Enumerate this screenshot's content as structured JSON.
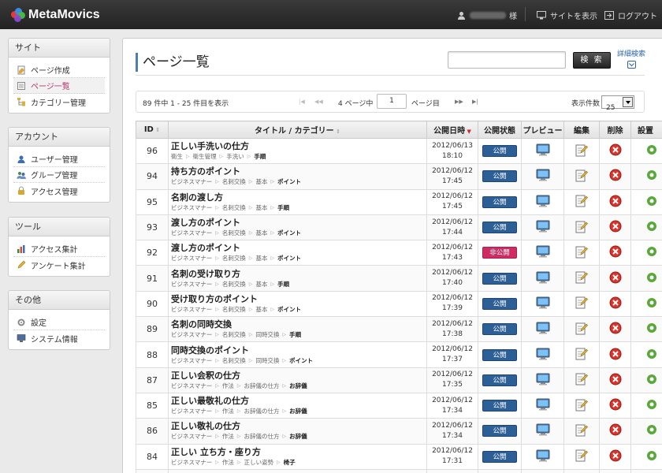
{
  "app": {
    "name": "MetaMovics"
  },
  "topbar": {
    "user_suffix": "様",
    "view_site": "サイトを表示",
    "logout": "ログアウト"
  },
  "sidebar": [
    {
      "heading": "サイト",
      "items": [
        {
          "label": "ページ作成",
          "icon": "page-create-icon"
        },
        {
          "label": "ページ一覧",
          "icon": "page-list-icon",
          "active": true
        },
        {
          "label": "カテゴリー管理",
          "icon": "category-icon"
        }
      ]
    },
    {
      "heading": "アカウント",
      "items": [
        {
          "label": "ユーザー管理",
          "icon": "user-icon"
        },
        {
          "label": "グループ管理",
          "icon": "group-icon"
        },
        {
          "label": "アクセス管理",
          "icon": "lock-icon"
        }
      ]
    },
    {
      "heading": "ツール",
      "items": [
        {
          "label": "アクセス集計",
          "icon": "bar-chart-icon"
        },
        {
          "label": "アンケート集計",
          "icon": "pen-icon"
        }
      ]
    },
    {
      "heading": "その他",
      "items": [
        {
          "label": "設定",
          "icon": "gear-icon"
        },
        {
          "label": "システム情報",
          "icon": "monitor-icon"
        }
      ]
    }
  ],
  "main": {
    "title": "ページ一覧",
    "search_button": "検 索",
    "advanced_search": "詳細検索",
    "pager": {
      "summary": "89 件中 1 - 25 件目を表示",
      "first": "|◀",
      "prev": "◀◀",
      "page_prefix": "4 ページ中",
      "page_value": "1",
      "page_suffix": "ページ目",
      "next": "▶▶",
      "last": "▶|",
      "per_page_label": "表示件数",
      "per_page_value": "25"
    },
    "columns": [
      "ID",
      "タイトル / カテゴリー",
      "公開日時",
      "公開状態",
      "プレビュー",
      "編集",
      "削除",
      "設置"
    ],
    "rows": [
      {
        "id": "96",
        "title": "正しい手洗いの仕方",
        "cats": [
          "衛生",
          "衛生管理",
          "手洗い",
          "手順"
        ],
        "date": "2012/06/13",
        "time": "18:10",
        "status": "公開",
        "published": true
      },
      {
        "id": "94",
        "title": "持ち方のポイント",
        "cats": [
          "ビジネスマナー",
          "名刺交換",
          "基本",
          "ポイント"
        ],
        "date": "2012/06/12",
        "time": "17:45",
        "status": "公開",
        "published": true
      },
      {
        "id": "95",
        "title": "名刺の渡し方",
        "cats": [
          "ビジネスマナー",
          "名刺交換",
          "基本",
          "手順"
        ],
        "date": "2012/06/12",
        "time": "17:45",
        "status": "公開",
        "published": true
      },
      {
        "id": "93",
        "title": "渡し方のポイント",
        "cats": [
          "ビジネスマナー",
          "名刺交換",
          "基本",
          "ポイント"
        ],
        "date": "2012/06/12",
        "time": "17:44",
        "status": "公開",
        "published": true
      },
      {
        "id": "92",
        "title": "渡し方のポイント",
        "cats": [
          "ビジネスマナー",
          "名刺交換",
          "基本",
          "ポイント"
        ],
        "date": "2012/06/12",
        "time": "17:43",
        "status": "非公開",
        "published": false
      },
      {
        "id": "91",
        "title": "名刺の受け取り方",
        "cats": [
          "ビジネスマナー",
          "名刺交換",
          "基本",
          "手順"
        ],
        "date": "2012/06/12",
        "time": "17:40",
        "status": "公開",
        "published": true
      },
      {
        "id": "90",
        "title": "受け取り方のポイント",
        "cats": [
          "ビジネスマナー",
          "名刺交換",
          "基本",
          "ポイント"
        ],
        "date": "2012/06/12",
        "time": "17:39",
        "status": "公開",
        "published": true
      },
      {
        "id": "89",
        "title": "名刺の同時交換",
        "cats": [
          "ビジネスマナー",
          "名刺交換",
          "同時交換",
          "手順"
        ],
        "date": "2012/06/12",
        "time": "17:38",
        "status": "公開",
        "published": true
      },
      {
        "id": "88",
        "title": "同時交換のポイント",
        "cats": [
          "ビジネスマナー",
          "名刺交換",
          "同時交換",
          "ポイント"
        ],
        "date": "2012/06/12",
        "time": "17:37",
        "status": "公開",
        "published": true
      },
      {
        "id": "87",
        "title": "正しい会釈の仕方",
        "cats": [
          "ビジネスマナー",
          "作法",
          "お辞儀の仕方",
          "お辞儀"
        ],
        "date": "2012/06/12",
        "time": "17:35",
        "status": "公開",
        "published": true
      },
      {
        "id": "85",
        "title": "正しい最敬礼の仕方",
        "cats": [
          "ビジネスマナー",
          "作法",
          "お辞儀の仕方",
          "お辞儀"
        ],
        "date": "2012/06/12",
        "time": "17:34",
        "status": "公開",
        "published": true
      },
      {
        "id": "86",
        "title": "正しい敬礼の仕方",
        "cats": [
          "ビジネスマナー",
          "作法",
          "お辞儀の仕方",
          "お辞儀"
        ],
        "date": "2012/06/12",
        "time": "17:34",
        "status": "公開",
        "published": true
      },
      {
        "id": "84",
        "title": "正しい 立ち方・座り方",
        "cats": [
          "ビジネスマナー",
          "作法",
          "正しい姿勢",
          "椅子"
        ],
        "date": "2012/06/12",
        "time": "17:31",
        "status": "公開",
        "published": true
      },
      {
        "id": "",
        "title": "",
        "cats": [],
        "date": "",
        "time": "",
        "status": "",
        "published": true
      }
    ]
  }
}
